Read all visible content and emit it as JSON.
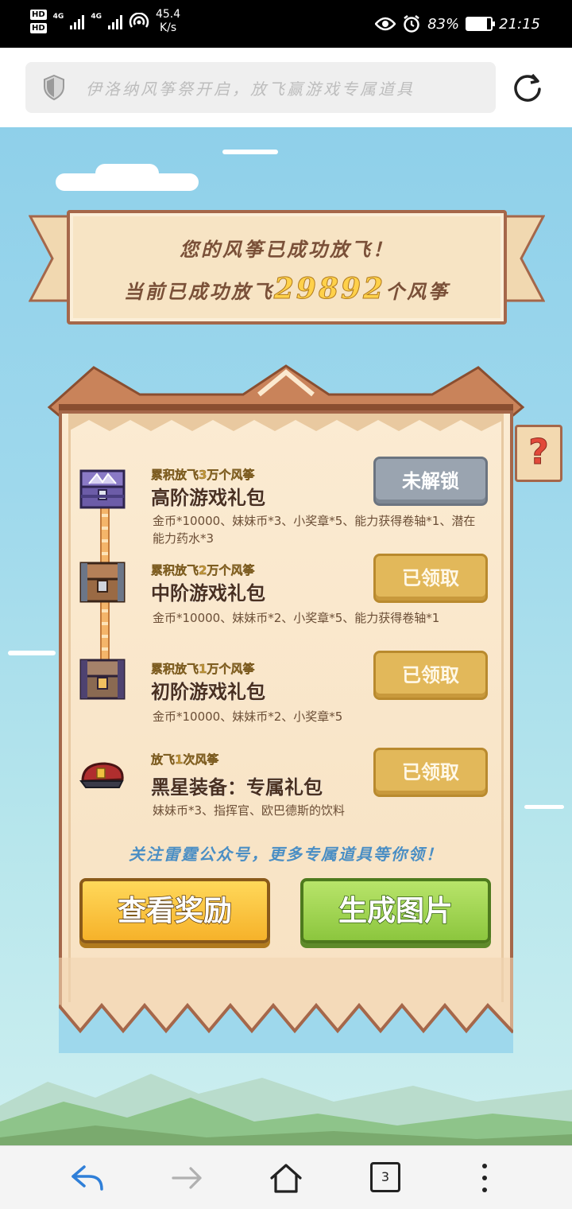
{
  "status_bar": {
    "hd1": "HD",
    "hd2": "HD",
    "net1": "4G",
    "net2": "4G",
    "speed_value": "45.4",
    "speed_unit": "K/s",
    "battery_percent": "83%",
    "battery_level": 0.83,
    "time": "21:15"
  },
  "url_bar": {
    "text": "伊洛纳风筝祭开启，放飞赢游戏专属道具",
    "security_icon": "shield-icon",
    "refresh_icon": "refresh-icon"
  },
  "banner": {
    "line1": "您的风筝已成功放飞！",
    "line2_prefix": "当前已成功放飞",
    "count": "29892",
    "line2_suffix": "个风筝"
  },
  "help": {
    "label": "?"
  },
  "tiers": [
    {
      "requirement": "累积放飞3万个风筝",
      "name": "高阶游戏礼包",
      "desc": "金币*10000、妹妹币*3、小奖章*5、能力获得卷轴*1、潜在能力药水*3",
      "button": "未解锁",
      "state": "locked",
      "icon": "treasure-chest-icon"
    },
    {
      "requirement": "累积放飞2万个风筝",
      "name": "中阶游戏礼包",
      "desc": "金币*10000、妹妹币*2、小奖章*5、能力获得卷轴*1",
      "button": "已领取",
      "state": "claimed",
      "icon": "treasure-chest-icon"
    },
    {
      "requirement": "累积放飞1万个风筝",
      "name": "初阶游戏礼包",
      "desc": "金币*10000、妹妹币*2、小奖章*5",
      "button": "已领取",
      "state": "claimed",
      "icon": "treasure-chest-icon"
    },
    {
      "requirement": "放飞1次风筝",
      "name": "黑星装备：专属礼包",
      "desc": "妹妹币*3、指挥官、欧巴德斯的饮料",
      "button": "已领取",
      "state": "claimed",
      "icon": "commander-hat-icon"
    }
  ],
  "follow_text": "关注雷霆公众号，更多专属道具等你领！",
  "buttons": {
    "view_rewards": "查看奖励",
    "generate_image": "生成图片"
  },
  "bottom_nav": {
    "back": "back-arrow-icon",
    "forward": "forward-arrow-icon",
    "home": "home-icon",
    "tabs_count": "3",
    "menu": "more-vertical-icon"
  },
  "colors": {
    "sky": "#9ed8ec",
    "panel": "#f7e1c1",
    "border": "#a5674a",
    "gold": "#ffd14a",
    "green_button": "#8cc63e",
    "yellow_button": "#f6b22a"
  }
}
